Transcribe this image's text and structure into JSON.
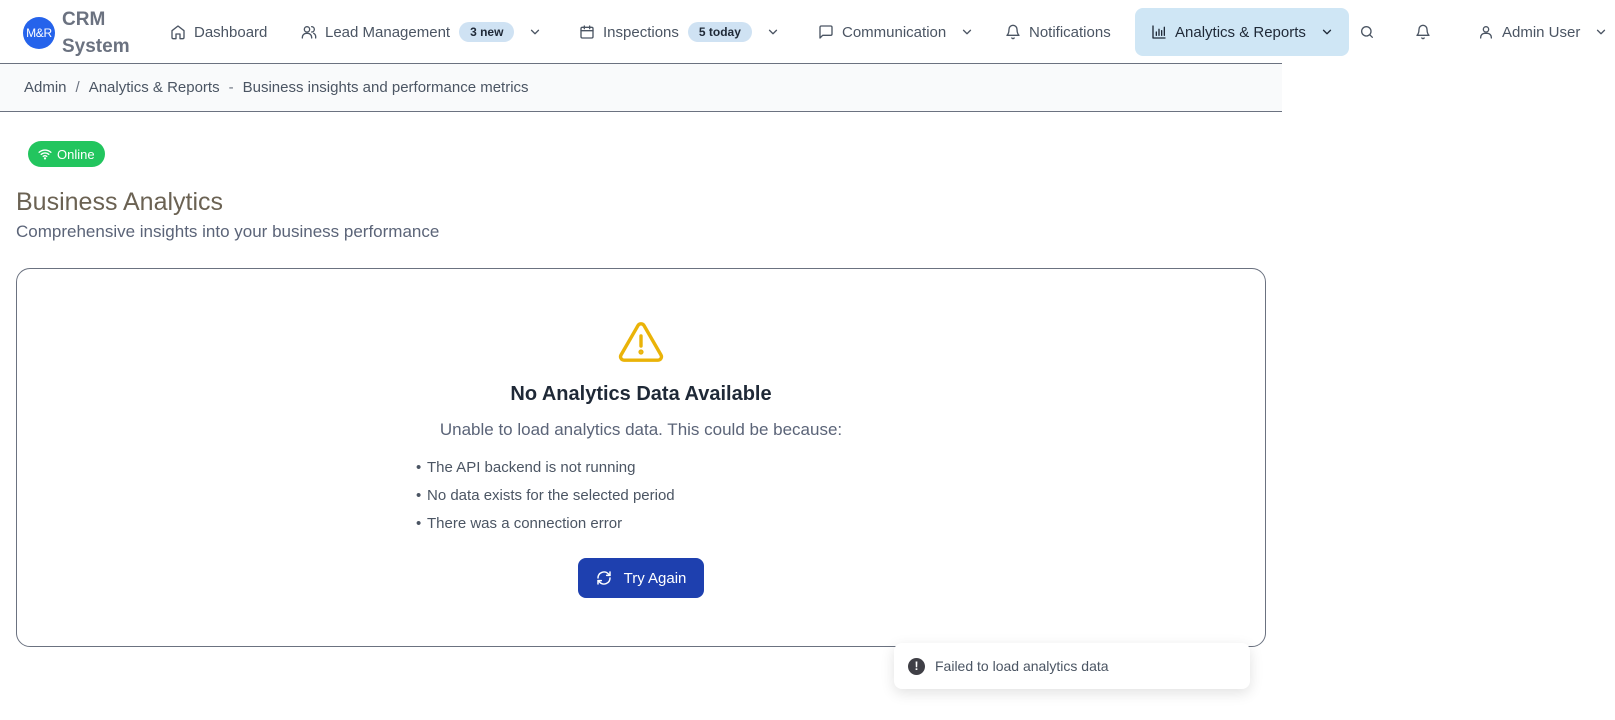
{
  "brand": {
    "logo_text": "M&R",
    "name": "CRM System"
  },
  "nav": {
    "dashboard": {
      "label": "Dashboard",
      "icon": "home-icon"
    },
    "leads": {
      "label": "Lead Management",
      "badge": "3 new",
      "icon": "users-icon"
    },
    "inspections": {
      "label": "Inspections",
      "badge": "5 today",
      "icon": "calendar-icon"
    },
    "communication": {
      "label": "Communication",
      "icon": "message-icon"
    },
    "notifications": {
      "label": "Notifications",
      "icon": "bell-icon"
    },
    "analytics": {
      "label": "Analytics & Reports",
      "icon": "bar-chart-icon",
      "active": true
    },
    "user": {
      "label": "Admin User",
      "icon": "user-icon"
    }
  },
  "breadcrumb": {
    "root": "Admin",
    "separator": "/",
    "current": "Analytics & Reports",
    "dash": "-",
    "description": "Business insights and performance metrics"
  },
  "status": {
    "label": "Online",
    "color": "#22c55e"
  },
  "page": {
    "title": "Business Analytics",
    "subtitle": "Comprehensive insights into your business performance"
  },
  "empty_state": {
    "title": "No Analytics Data Available",
    "subtitle": "Unable to load analytics data. This could be because:",
    "reasons": [
      "The API backend is not running",
      "No data exists for the selected period",
      "There was a connection error"
    ],
    "retry_label": "Try Again",
    "warning_color": "#eab308"
  },
  "toast": {
    "message": "Failed to load analytics data",
    "icon": "alert-circle-icon"
  },
  "colors": {
    "accent": "#1e40af",
    "active_nav": "#cfe6f5",
    "badge_bg": "#cfe2f3"
  }
}
